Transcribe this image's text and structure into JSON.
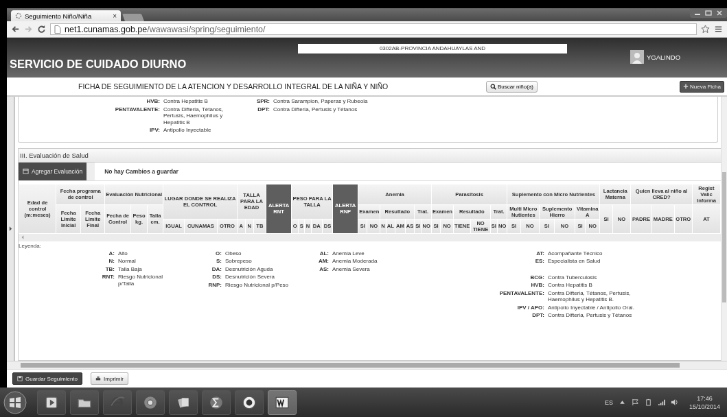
{
  "browser": {
    "tab": {
      "title": "Seguimiento Niño/Niña",
      "close": "×"
    },
    "url": {
      "domain": "net1.cunamas.gob.pe",
      "path": "/wawawasi/spring/seguimiento/"
    }
  },
  "header": {
    "title": "SERVICIO DE CUIDADO DIURNO",
    "location": "0302AB-PROVINCIA ANDAHUAYLAS AND",
    "user": "YGALINDO"
  },
  "ficha": {
    "title": "FICHA DE SEGUIMIENTO DE LA ATENCION Y DESARROLLO INTEGRAL DE LA NIÑA Y NIÑO",
    "search_button": "Buscar niño(a)",
    "new_button": "Nueva Ficha"
  },
  "vaccines": {
    "columns": [
      [
        {
          "code": "HVB:",
          "text": "Contra Hepatitis B"
        },
        {
          "code": "PENTAVALENTE:",
          "text": "Contra Difteria, Tétanos, Pertusis, Haemophilus y Hepatitis B"
        },
        {
          "code": "IPV:",
          "text": "Antipolio Inyectable"
        }
      ],
      [
        {
          "code": "SPR:",
          "text": "Contra Sarampion, Paperas y Rubeola"
        },
        {
          "code": "DPT:",
          "text": "Contra Difteria, Pertusis y Tétanos"
        }
      ]
    ]
  },
  "section": {
    "title": "III. Evaluación de Salud",
    "add_button": "Agregar Evaluación",
    "status": "No hay Cambios a guardar",
    "columns": [
      {
        "label": "Edad de control (m:meses)",
        "kind": "group"
      },
      {
        "label": "Fecha programa de control",
        "kind": "group",
        "children": [
          {
            "label": "Fecha Limite Inicial"
          },
          {
            "label": "Fecha Limite Final"
          }
        ]
      },
      {
        "label": "Evaluación Nutricional",
        "kind": "group",
        "children": [
          {
            "label": "Fecha de Control"
          },
          {
            "label": "Peso kg."
          },
          {
            "label": "Talla cm."
          }
        ]
      },
      {
        "label": "LUGAR DONDE SE REALIZA EL CONTROL",
        "kind": "tall",
        "children": [
          {
            "label": "IGUAL"
          },
          {
            "label": "CUNAMAS"
          },
          {
            "label": "OTRO"
          }
        ]
      },
      {
        "label": "TALLA PARA LA EDAD",
        "kind": "tall",
        "children": [
          {
            "label": "A"
          },
          {
            "label": "N"
          },
          {
            "label": "TB"
          }
        ]
      },
      {
        "label": "ALERTA RNT",
        "kind": "alert"
      },
      {
        "label": "PESO PARA LA TALLA",
        "kind": "tall",
        "children": [
          {
            "label": "O"
          },
          {
            "label": "S"
          },
          {
            "label": "N"
          },
          {
            "label": "DA"
          },
          {
            "label": "DS"
          }
        ]
      },
      {
        "label": "ALERTA RNP",
        "kind": "alert"
      },
      {
        "label": "Anemia",
        "kind": "group",
        "children": [
          {
            "label": "Examen",
            "children": [
              {
                "label": "SI"
              },
              {
                "label": "NO"
              }
            ]
          },
          {
            "label": "Resultado",
            "children": [
              {
                "label": "N"
              },
              {
                "label": "AL"
              },
              {
                "label": "AM"
              },
              {
                "label": "AS"
              }
            ]
          },
          {
            "label": "Trat.",
            "children": [
              {
                "label": "SI"
              },
              {
                "label": "NO"
              }
            ]
          }
        ]
      },
      {
        "label": "Parasitosis",
        "kind": "group",
        "children": [
          {
            "label": "Examen",
            "children": [
              {
                "label": "SI"
              },
              {
                "label": "NO"
              }
            ]
          },
          {
            "label": "Resultado",
            "children": [
              {
                "label": "TIENE"
              },
              {
                "label": "NO TIENE"
              }
            ]
          },
          {
            "label": "Trat.",
            "children": [
              {
                "label": "SI"
              },
              {
                "label": "NO"
              }
            ]
          }
        ]
      },
      {
        "label": "Suplemento con Micro Nutrientes",
        "kind": "group",
        "children": [
          {
            "label": "Multi Micro Nutientes",
            "children": [
              {
                "label": "SI"
              },
              {
                "label": "NO"
              }
            ]
          },
          {
            "label": "Suplemento Hierro",
            "children": [
              {
                "label": "SI"
              },
              {
                "label": "NO"
              }
            ]
          },
          {
            "label": "Vitamina A",
            "children": [
              {
                "label": "SI"
              },
              {
                "label": "NO"
              }
            ]
          }
        ]
      },
      {
        "label": "Lactancia Materna",
        "kind": "group",
        "children": [
          {
            "label": "SI"
          },
          {
            "label": "NO"
          }
        ]
      },
      {
        "label": "Quien lleva al niño al CRED?",
        "kind": "group",
        "children": [
          {
            "label": "PADRE"
          },
          {
            "label": "MADRE"
          },
          {
            "label": "OTRO"
          }
        ]
      },
      {
        "label": "Regist Valic Informa",
        "kind": "group",
        "children": [
          {
            "label": "AT"
          }
        ]
      }
    ]
  },
  "legend": {
    "title": "Leyenda:",
    "columns": [
      [
        [
          {
            "code": "A:",
            "text": "Alto"
          },
          {
            "code": "N:",
            "text": "Normal"
          },
          {
            "code": "TB:",
            "text": "Talla Baja"
          },
          {
            "code": "RNT:",
            "text": "Riesgo Nutricional p/Talla"
          }
        ]
      ],
      [
        [
          {
            "code": "O:",
            "text": "Obeso"
          },
          {
            "code": "S:",
            "text": "Sobrepeso"
          },
          {
            "code": "DA:",
            "text": "Desnutrición Aguda"
          },
          {
            "code": "DS:",
            "text": "Desnutrición Severa"
          },
          {
            "code": "RNP:",
            "text": "Riesgo Nutricional p/Peso"
          }
        ]
      ],
      [
        [
          {
            "code": "AL:",
            "text": "Anemia Leve"
          },
          {
            "code": "AM:",
            "text": "Anemia Moderada"
          },
          {
            "code": "AS:",
            "text": "Anemia Severa"
          }
        ]
      ],
      [
        [
          {
            "code": "AT:",
            "text": "Acompañante Técnico"
          },
          {
            "code": "ES:",
            "text": "Especialista en Salud"
          }
        ],
        [
          {
            "code": "BCG:",
            "text": "Contra Tuberculosis"
          },
          {
            "code": "HVB:",
            "text": "Contra Hepatitis B"
          },
          {
            "code": "PENTAVALENTE:",
            "text": "Contra Difteria, Tétanos, Pertusis, Haemophilus y Hepatitis B."
          },
          {
            "code": "IPV / APO:",
            "text": "Antipolio Inyectable / Antipolio Oral."
          },
          {
            "code": "DPT:",
            "text": "Contra Difteria, Pertusis y Tétanos"
          }
        ]
      ]
    ]
  },
  "footer": {
    "buttons": [
      {
        "label": "Guardar Seguimiento",
        "kind": "primary"
      },
      {
        "label": "Imprimir",
        "kind": "secondary"
      }
    ]
  },
  "tray": {
    "language": "ES",
    "time": "17:46",
    "date": "15/10/2014"
  }
}
